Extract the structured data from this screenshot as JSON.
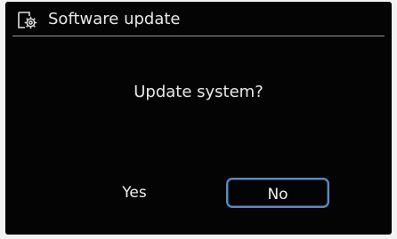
{
  "dialog": {
    "title": "Software update",
    "title_icon": "device-settings-icon",
    "prompt": "Update system?",
    "buttons": {
      "yes_label": "Yes",
      "no_label": "No",
      "focused": "No"
    }
  },
  "colors": {
    "background": "#040404",
    "text": "#e8e8e8",
    "focus_border": "#5a8cc0",
    "divider": "#9a9a9a"
  }
}
